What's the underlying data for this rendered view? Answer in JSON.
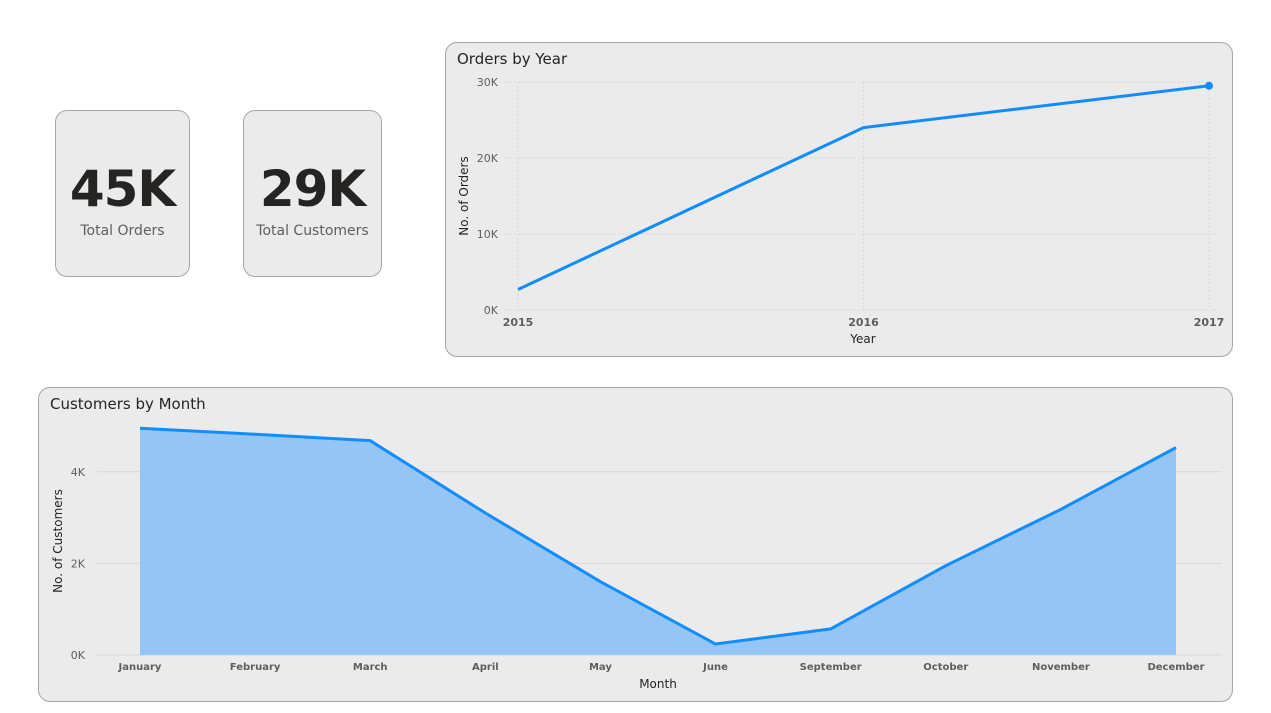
{
  "kpis": {
    "orders": {
      "value": "45K",
      "label": "Total Orders"
    },
    "customers": {
      "value": "29K",
      "label": "Total Customers"
    }
  },
  "colors": {
    "accent": "#118dff",
    "area_fill": "#94c5f4",
    "panel_bg": "#ebebeb"
  },
  "chart_data": [
    {
      "type": "line",
      "title": "Orders by Year",
      "xlabel": "Year",
      "ylabel": "No. of Orders",
      "categories": [
        "2015",
        "2016",
        "2017"
      ],
      "values": [
        2700,
        24000,
        29500
      ],
      "ylim": [
        0,
        30000
      ],
      "yticks": [
        0,
        10000,
        20000,
        30000
      ],
      "ytick_labels": [
        "0K",
        "10K",
        "20K",
        "30K"
      ],
      "grid": true,
      "legend": "none"
    },
    {
      "type": "area",
      "title": "Customers by Month",
      "xlabel": "Month",
      "ylabel": "No. of Customers",
      "categories": [
        "January",
        "February",
        "March",
        "April",
        "May",
        "June",
        "September",
        "October",
        "November",
        "December"
      ],
      "values": [
        4950,
        4820,
        4680,
        3100,
        1600,
        240,
        570,
        1950,
        3180,
        4530
      ],
      "ylim": [
        0,
        5000
      ],
      "yticks": [
        0,
        2000,
        4000
      ],
      "ytick_labels": [
        "0K",
        "2K",
        "4K"
      ],
      "grid": true,
      "legend": "none"
    }
  ]
}
